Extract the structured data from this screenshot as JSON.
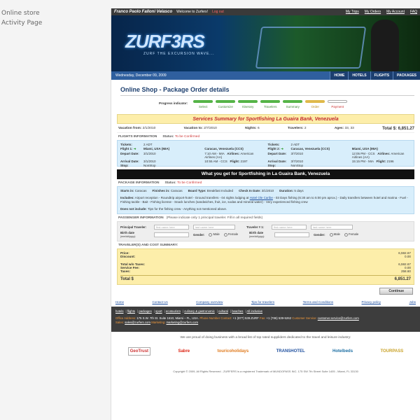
{
  "side_label": [
    "Online store",
    "Activity Page"
  ],
  "topbar": {
    "user": "Franco Paolo Falloni Velasco",
    "welcome": "Welcome to Zurfers!",
    "logout": "Log out",
    "nav": [
      "My Trips",
      "My Orders",
      "My Account",
      "FAQ"
    ]
  },
  "banner": {
    "logo": "ZURF3RS",
    "tagline": "ZURF THE EXCURSION WAVE..."
  },
  "datebar": {
    "date": "Wednesday, December 09, 2009",
    "menu": [
      "HOME",
      "HOTELS",
      "FLIGHTS",
      "PACKAGES"
    ]
  },
  "page_title": "Online Shop - Package Order details",
  "progress": {
    "label": "Progress indicator:",
    "steps": [
      {
        "label": "Select",
        "state": "done"
      },
      {
        "label": "Customize",
        "state": "done"
      },
      {
        "label": "Itinerary",
        "state": "done"
      },
      {
        "label": "Travelers",
        "state": "done"
      },
      {
        "label": "Summary",
        "state": "done"
      },
      {
        "label": "Order",
        "state": "current"
      },
      {
        "label": "Payment",
        "state": "todo"
      }
    ]
  },
  "summary": {
    "heading": "Services Summary for Sportfishing La Guaira Bank, Venezuela",
    "vacation_from_label": "Vacation from:",
    "vacation_from": "2/1/2010",
    "vacation_to_label": "Vacation to:",
    "vacation_to": "2/7/2010",
    "nights_label": "Nights:",
    "nights": "6",
    "travelers_label": "Travelers:",
    "travelers": "2",
    "ages_label": "Ages:",
    "ages": "33, 33",
    "total_label": "Total $:",
    "total": "6,851.27"
  },
  "flights": {
    "section": "FLIGHTS INFORMATION",
    "status_label": "Status:",
    "status": "To be Confirmed",
    "flight1": {
      "tickets": "2 ADT",
      "label": "Flight 1:",
      "route": "Miami, USA (MIA)",
      "to": "Caracas, Venezuela (CCS)",
      "depart": "3/1/2010",
      "depart_time": "7:10 AM - MIA",
      "arrival": "3/1/2010",
      "arrival_time": "10:55 AM - CCS",
      "airline": "American Airlines (AA)",
      "flight": "2197",
      "stop": "NonStop"
    },
    "flight2": {
      "tickets": "2 ADT",
      "label": "Flight 2:",
      "route": "Caracas, Venezuela (CCS)",
      "to": "Miami, USA (MIA)",
      "depart": "3/7/2010",
      "depart_time": "12:05 PM - CCS",
      "arrival": "3/7/2010",
      "arrival_time": "15:15 PM - MIA",
      "airline": "American Airlines (AA)",
      "flight": "2196",
      "stop": "NonStop"
    },
    "labels": {
      "tickets": "Tickets:",
      "depart": "Depart Date:",
      "arrival": "Arrival Date:",
      "stop": "Stop:",
      "airlines": "Airlines:",
      "flight": "Flight:"
    }
  },
  "what_you_get": "What you get for Sportfishing in La Guaira Bank, Venezuela",
  "package": {
    "section": "PACKAGE INFORMATION",
    "status_label": "Status:",
    "status": "To be Confirmed",
    "starts_label": "Starts in:",
    "starts": "Caracas",
    "finishes_label": "Finishes in:",
    "finishes": "Caracas",
    "board_label": "Board Type:",
    "board": "Breakfast Included",
    "checkin_label": "Check In Date:",
    "checkin": "3/1/2010",
    "duration_label": "Duration:",
    "duration": "5 days",
    "includes_label": "Includes:",
    "includes_a": "Airport reception - Roundtrip airport-hotel - Ground transfers - 04 nights lodging at",
    "includes_link": "Hotel Ole Caribe",
    "includes_b": "- 03 Days fishing (6:30 am to 5:00 pm aprox.) - Daily transfers between hotel and marina - Fuel - Fishing tackle - Bait - Fishing license - Snack lunches (sandwiches, fruit, ice, sodas and mineral water) - Very experienced fishing crew",
    "not_include_label": "Does not include:",
    "not_include": "Tips for the fishing crew - Anything not mentioned above."
  },
  "passenger": {
    "section": "PASSENGER INFORMATION",
    "note": "(Please indicate only 1 principal traveler. Fill in all required fields)",
    "principal_label": "Principal Traveler:",
    "traveler2_label": "Traveler # 1:",
    "first_placeholder": "first name here",
    "last_placeholder": "last name here",
    "birth_label": "Birth date",
    "birth_hint": "(mm/dd/yyyy):",
    "gender_label": "Gender:",
    "male": "Male",
    "female": "Female"
  },
  "cost": {
    "section": "TRAVELER(S) AND COST SUMMARY:",
    "price_label": "Price:",
    "price": "6,592.67",
    "discount_label": "Discount:",
    "discount": "0.00",
    "wo_taxes_label": "Total w/o Taxes:",
    "wo_taxes": "6,592.67",
    "service_label": "Service Fee:",
    "service": "0.00",
    "taxes_label": "Taxes:",
    "taxes": "258.60",
    "total_label": "Total $",
    "total": "6,851.27"
  },
  "continue_label": "Continue",
  "footer_links": [
    "Home",
    "Contact Us",
    "Company overview",
    "Tips for travelers",
    "Terms and Conditions",
    "Privacy policy",
    "Jobs"
  ],
  "darkfoot": {
    "links": [
      "hotels",
      "flights",
      "packages",
      "sport",
      "ecotourism",
      "culinary & gastronomic",
      "cultural",
      "beaches",
      "All inclusive"
    ],
    "office_label": "Office Address:",
    "office": "175 S.W. 7th St. Suite 1610, Miami – FL, USA.",
    "phone_label": "Phone Number Contact:",
    "phone": "+1 (877) 539.ZURF",
    "fax_label": "Fax:",
    "fax": "+1 (786) 539-5262",
    "cs_label": "Customer Service:",
    "cs": "customer.service@zurfers.com",
    "sales_label": "Sales:",
    "sales": "sales@zurfers.com",
    "marketing_label": "Marketing:",
    "marketing": "marketing@zurfers.com"
  },
  "proud": "We are proud of doing business with a broad list of top rated suppliders dedicated to the travel and leisure industry:",
  "partners": [
    "GeoTrust",
    "Sabre",
    "touricoholidays",
    "TRANSHOTEL",
    "Hotelbeds",
    "TOURPASS"
  ],
  "copyright": "Copyright © 2009, All Rights Reserved - ZURFERS is a registered Trademark of MUNDOPASS INC. 175 SW 7th Street Suite 1405 - Miami, FL 33130",
  "colors": {
    "brand_blue": "#2f5f9e",
    "alert_red": "#c3282d",
    "highlight_yellow": "#fdeeaa",
    "info_blue": "#d8eefb"
  }
}
